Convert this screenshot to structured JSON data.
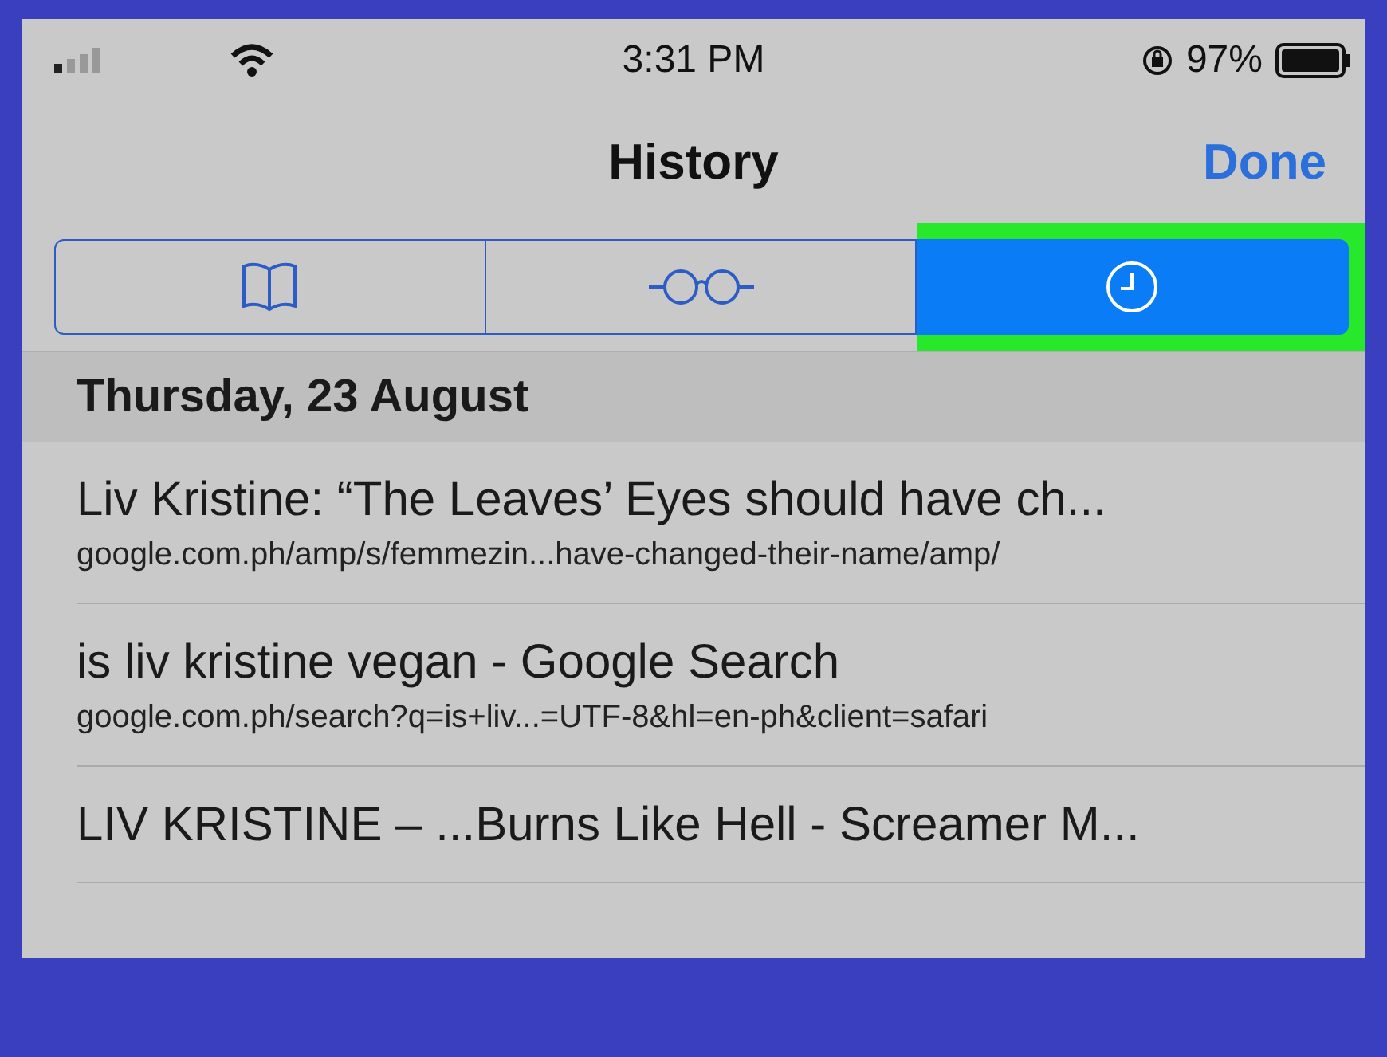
{
  "status_bar": {
    "time": "3:31 PM",
    "battery": "97%"
  },
  "nav": {
    "title": "History",
    "done": "Done"
  },
  "tabs": [
    {
      "kind": "bookmarks",
      "selected": false,
      "highlighted": false
    },
    {
      "kind": "reading-list",
      "selected": false,
      "highlighted": false
    },
    {
      "kind": "history",
      "selected": true,
      "highlighted": true
    }
  ],
  "section": {
    "header": "Thursday, 23 August"
  },
  "rows": [
    {
      "title": "Liv Kristine: “The Leaves’ Eyes should have ch...",
      "url": "google.com.ph/amp/s/femmezin...have-changed-their-name/amp/"
    },
    {
      "title": "is liv kristine vegan - Google Search",
      "url": "google.com.ph/search?q=is+liv...=UTF-8&hl=en-ph&client=safari"
    },
    {
      "title": "LIV KRISTINE – ...Burns Like Hell - Screamer M..."
    }
  ]
}
